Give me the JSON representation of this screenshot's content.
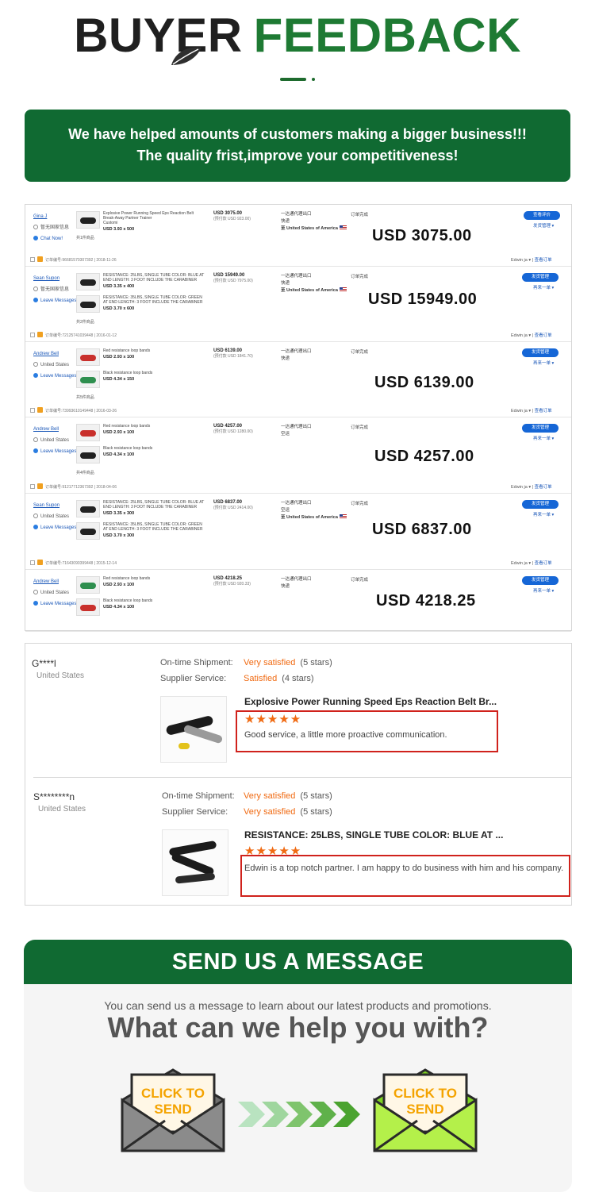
{
  "header": {
    "title_part1": "BUYER",
    "title_part2": "FEEDBACK"
  },
  "banner": {
    "line1": "We have helped amounts of customers making a bigger business!!!",
    "line2": "The quality frist,improve your competitiveness!"
  },
  "orders": [
    {
      "buyer": "Gina J",
      "location": "暂无国家信息",
      "contact": "Chat Now!",
      "items": [
        {
          "desc": "Explosive Power Running Speed Eps Reaction Belt Break-Away Partner Trainer",
          "extra": "Customi",
          "size": "USD 3.93 x 500"
        }
      ],
      "total_label": "共1件商品",
      "amount": "USD 3075.00",
      "amount_sub": "(预付款 USD 923.00)",
      "ship": "一达通代理出口",
      "method": "快递",
      "dest": "至 United States of America",
      "status": "订单完成",
      "button": "查看评价",
      "link": "发货管理 ▾",
      "big_amount": "USD 3075.00",
      "order_no": "订单编号:96681570307392",
      "date": "2018-11-26",
      "agent": "Edwin ja ▾",
      "agent_link": "查看订单"
    },
    {
      "buyer": "Sean Supon",
      "location": "暂无国家信息",
      "contact": "Leave Messages",
      "items": [
        {
          "desc": "RESISTANCE: 25LBS, SINGLE TUBE COLOR: BLUE AT END LENGTH: 3 FOOT INCLUDE THE CARABINER",
          "extra": "",
          "size": "USD 3.35 x 400"
        },
        {
          "desc": "RESISTANCE: 35LBS, SINGLE TUBE COLOR: GREEN AT END LENGTH: 3 FOOT INCLUDE THE CARABINER",
          "extra": "",
          "size": "USD 3.70 x 600"
        }
      ],
      "total_label": "共2件商品",
      "amount": "USD 15949.00",
      "amount_sub": "(预付款 USD 7975.00)",
      "ship": "一达通代理出口",
      "method": "快递",
      "dest": "至 United States of America",
      "status": "订单完成",
      "button": "发货管理",
      "link": "再来一单 ▾",
      "big_amount": "USD 15949.00",
      "order_no": "订单编号:72125741039448",
      "date": "2016-01-12",
      "agent": "Edwin ja ▾",
      "agent_link": "查看订单"
    },
    {
      "buyer": "Andrew Bell",
      "location": "United States",
      "contact": "Leave Messages",
      "items": [
        {
          "desc": "Red resistance loop bands",
          "extra": "",
          "size": "USD 2.93 x 100"
        },
        {
          "desc": "Black resistance loop bands",
          "extra": "",
          "size": "USD 4.34 x 150"
        }
      ],
      "total_label": "共5件商品",
      "amount": "USD 6139.00",
      "amount_sub": "(预付款 USD 1841.70)",
      "ship": "一达通代理出口",
      "method": "快递",
      "dest": "",
      "status": "订单完成",
      "button": "发货管理",
      "link": "再来一单 ▾",
      "big_amount": "USD 6139.00",
      "order_no": "订单编号:73993610149448",
      "date": "2016-03-26",
      "agent": "Edwin ja ▾",
      "agent_link": "查看订单"
    },
    {
      "buyer": "Andrew Bell",
      "location": "United States",
      "contact": "Leave Messages",
      "items": [
        {
          "desc": "Red resistance loop bands",
          "extra": "",
          "size": "USD 2.93 x 100"
        },
        {
          "desc": "Black resistance loop bands",
          "extra": "",
          "size": "USD 4.34 x 100"
        }
      ],
      "total_label": "共4件商品",
      "amount": "USD 4257.00",
      "amount_sub": "(预付款 USD 1280.00)",
      "ship": "一达通代理出口",
      "method": "空运",
      "dest": "",
      "status": "订单完成",
      "button": "发货管理",
      "link": "再来一单 ▾",
      "big_amount": "USD 4257.00",
      "order_no": "订单编号:91217712367392",
      "date": "2018-04-06",
      "agent": "Edwin ja ▾",
      "agent_link": "查看订单"
    },
    {
      "buyer": "Sean Supon",
      "location": "United States",
      "contact": "Leave Messages",
      "items": [
        {
          "desc": "RESISTANCE: 25LBS, SINGLE TUBE COLOR: BLUE AT END LENGTH: 3 FOOT INCLUDE THE CARABINER",
          "extra": "",
          "size": "USD 3.35 x 300"
        },
        {
          "desc": "RESISTANCE: 35LBS, SINGLE TUBE COLOR: GREEN AT END LENGTH: 3 FOOT INCLUDE THE CARABINER",
          "extra": "",
          "size": "USD 3.70 x 300"
        }
      ],
      "total_label": "",
      "amount": "USD 6837.00",
      "amount_sub": "(预付款 USD 2414.00)",
      "ship": "一达通代理出口",
      "method": "空运",
      "dest": "至 United States of America",
      "status": "订单完成",
      "button": "发货管理",
      "link": "再来一单 ▾",
      "big_amount": "USD 6837.00",
      "order_no": "订单编号:71643090399448",
      "date": "2015-12-14",
      "agent": "Edwin ja ▾",
      "agent_link": "查看订单"
    },
    {
      "buyer": "Andrew Bell",
      "location": "United States",
      "contact": "Leave Messages",
      "items": [
        {
          "desc": "Red resistance loop bands",
          "extra": "",
          "size": "USD 2.93 x 100"
        },
        {
          "desc": "Black resistance loop bands",
          "extra": "",
          "size": "USD 4.34 x 100"
        }
      ],
      "total_label": "",
      "amount": "USD 4218.25",
      "amount_sub": "(预付款 USD 920.33)",
      "ship": "一达通代理出口",
      "method": "快递",
      "dest": "",
      "status": "订单完成",
      "button": "发货管理",
      "link": "再来一单 ▾",
      "big_amount": "USD 4218.25",
      "order_no": "",
      "date": "",
      "agent": "",
      "agent_link": ""
    }
  ],
  "reviews": [
    {
      "name": "G****l",
      "country": "United States",
      "ontime_label": "On-time Shipment:",
      "ontime_value": "Very satisfied",
      "ontime_stars": "(5 stars)",
      "service_label": "Supplier Service:",
      "service_value": "Satisfied",
      "service_stars": "(4 stars)",
      "product": "Explosive Power Running Speed Eps Reaction Belt Br...",
      "stars": "★★★★★",
      "comment": "Good service, a little more proactive communication."
    },
    {
      "name": "S********n",
      "country": "United States",
      "ontime_label": "On-time Shipment:",
      "ontime_value": "Very satisfied",
      "ontime_stars": "(5 stars)",
      "service_label": "Supplier Service:",
      "service_value": "Very satisfied",
      "service_stars": "(5 stars)",
      "product": "RESISTANCE: 25LBS, SINGLE TUBE COLOR: BLUE AT ...",
      "stars": "★★★★★",
      "comment": "Edwin is a top notch partner. I am happy to do business with him and his company."
    }
  ],
  "message": {
    "title": "SEND US A MESSAGE",
    "subtitle": "You can send us a message to learn about our latest products and promotions.",
    "question": "What can we help you with?",
    "button_left": "CLICK TO SEND",
    "button_right": "CLICK TO SEND"
  },
  "colors": {
    "brand_green": "#106a32",
    "link_blue": "#1a57b8",
    "accent_orange": "#f06a12",
    "highlight_red": "#d0221c"
  }
}
